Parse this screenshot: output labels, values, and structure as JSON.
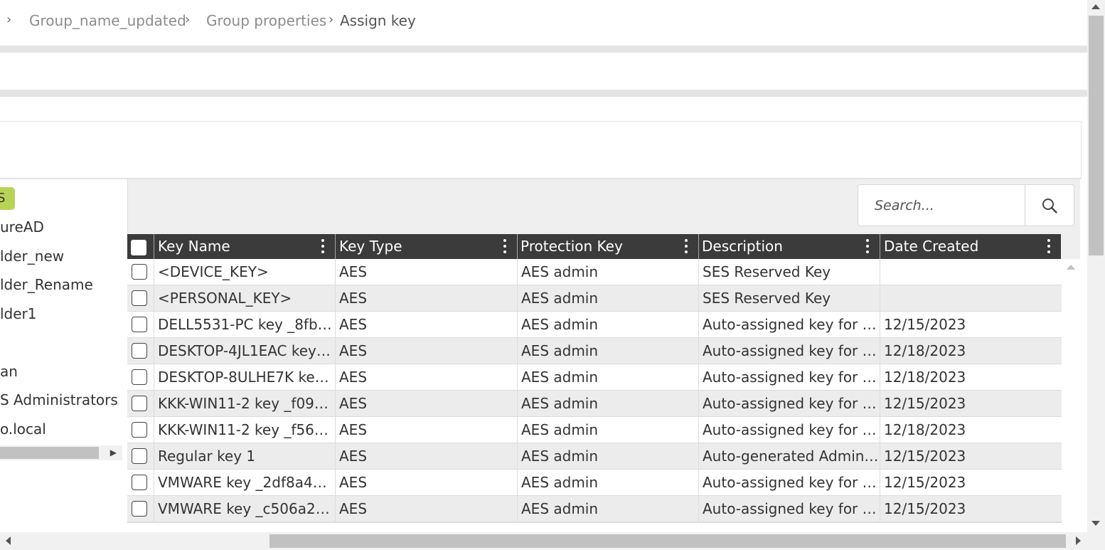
{
  "breadcrumb": {
    "items": [
      "Group_name_updated",
      "Group properties",
      "Assign key"
    ],
    "separator": "›"
  },
  "tree": {
    "badge_label": "S",
    "items": [
      "ureAD",
      "lder_new",
      "lder_Rename",
      "lder1",
      "an",
      "S Administrators",
      "o.local"
    ]
  },
  "search": {
    "placeholder": "Search...",
    "icon": "search-icon"
  },
  "table": {
    "columns": [
      "Key Name",
      "Key Type",
      "Protection Key",
      "Description",
      "Date Created"
    ],
    "rows": [
      {
        "name": "<DEVICE_KEY>",
        "type": "AES",
        "protection": "AES admin",
        "description": "SES Reserved Key",
        "date": ""
      },
      {
        "name": "<PERSONAL_KEY>",
        "type": "AES",
        "protection": "AES admin",
        "description": "SES Reserved Key",
        "date": ""
      },
      {
        "name": "DELL5531-PC key _8fb3ad…",
        "type": "AES",
        "protection": "AES admin",
        "description": "Auto-assigned key for dev…",
        "date": "12/15/2023"
      },
      {
        "name": "DESKTOP-4JL1EAC key _8…",
        "type": "AES",
        "protection": "AES admin",
        "description": "Auto-assigned key for dev…",
        "date": "12/18/2023"
      },
      {
        "name": "DESKTOP-8ULHE7K key _…",
        "type": "AES",
        "protection": "AES admin",
        "description": "Auto-assigned key for dev…",
        "date": "12/18/2023"
      },
      {
        "name": "KKK-WIN11-2 key _f09266…",
        "type": "AES",
        "protection": "AES admin",
        "description": "Auto-assigned key for dev…",
        "date": "12/15/2023"
      },
      {
        "name": "KKK-WIN11-2 key _f5693f…",
        "type": "AES",
        "protection": "AES admin",
        "description": "Auto-assigned key for dev…",
        "date": "12/18/2023"
      },
      {
        "name": "Regular key 1",
        "type": "AES",
        "protection": "AES admin",
        "description": "Auto-generated Admin Pe…",
        "date": "12/15/2023"
      },
      {
        "name": "VMWARE key _2df8a4bae…",
        "type": "AES",
        "protection": "AES admin",
        "description": "Auto-assigned key for dev…",
        "date": "12/15/2023"
      },
      {
        "name": "VMWARE key _c506a2d2e…",
        "type": "AES",
        "protection": "AES admin",
        "description": "Auto-assigned key for dev…",
        "date": "12/15/2023"
      }
    ]
  },
  "colors": {
    "header_bg": "#3b3b3b",
    "badge": "#b8d455",
    "row_alt": "#ececec"
  }
}
